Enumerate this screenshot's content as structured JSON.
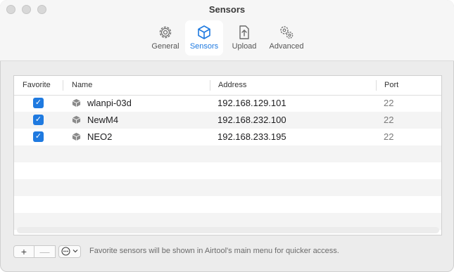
{
  "window": {
    "title": "Sensors"
  },
  "tabs": [
    {
      "label": "General",
      "icon": "gear-icon"
    },
    {
      "label": "Sensors",
      "icon": "cube-icon"
    },
    {
      "label": "Upload",
      "icon": "upload-icon"
    },
    {
      "label": "Advanced",
      "icon": "gears-icon"
    }
  ],
  "active_tab": "Sensors",
  "accent_color": "#1f7ae0",
  "table": {
    "columns": [
      "Favorite",
      "Name",
      "Address",
      "Port"
    ],
    "rows": [
      {
        "favorite": true,
        "name": "wlanpi-03d",
        "address": "192.168.129.101",
        "port": "22"
      },
      {
        "favorite": true,
        "name": "NewM4",
        "address": "192.168.232.100",
        "port": "22"
      },
      {
        "favorite": true,
        "name": "NEO2",
        "address": "192.168.233.195",
        "port": "22"
      }
    ]
  },
  "toolbar": {
    "add_label": "+",
    "remove_label": "—",
    "more_label": "⋯",
    "more_icon": "ellipsis-circle-icon"
  },
  "hint": "Favorite sensors will be shown in Airtool's main menu for quicker access."
}
